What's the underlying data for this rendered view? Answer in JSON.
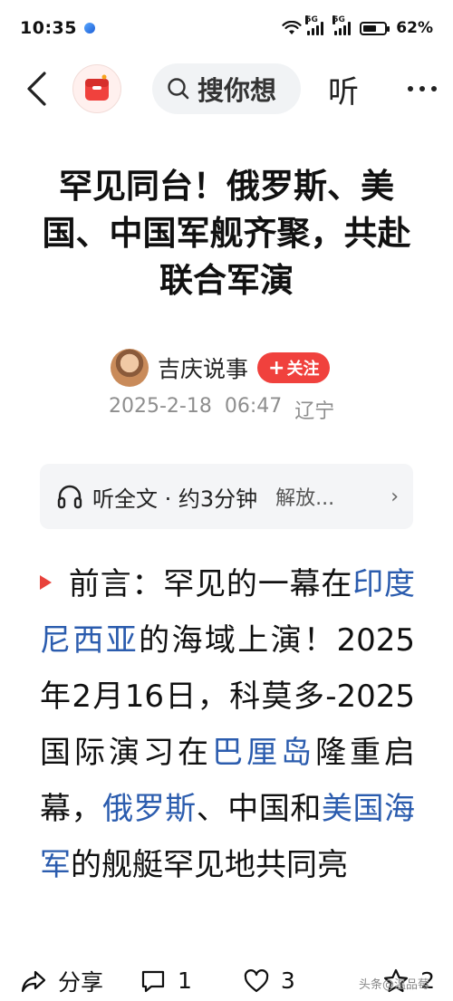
{
  "status_bar": {
    "time": "10:35",
    "network_1": "5G",
    "network_2": "5G",
    "battery_percent": "62%",
    "battery_level": 0.62
  },
  "nav": {
    "search_text": "搜你想",
    "listen_label": "听"
  },
  "article": {
    "title": "罕见同台！俄罗斯、美国、中国军舰齐聚，共赴联合军演",
    "author": "吉庆说事",
    "follow_label": "关注",
    "date": "2025-2-18",
    "time": "06:47",
    "location": "辽宁",
    "listen_bar": {
      "label": "听全文 · 约3分钟",
      "extra": "解放..."
    },
    "body": {
      "p1_prefix": "前言：罕见的一幕在",
      "link_1": "印度尼西亚",
      "p1_mid_1": "的海域上演！2025年2月16日，科莫多-2025国际演习在",
      "link_2": "巴厘岛",
      "p1_mid_2": "隆重启幕，",
      "link_3": "俄罗斯",
      "p1_mid_3": "、中国和",
      "link_4": "美国海军",
      "p1_suffix": "的舰艇罕见地共同亮"
    }
  },
  "bottom_bar": {
    "share_label": "分享",
    "comment_count": "1",
    "like_count": "3",
    "favorite_count": "2",
    "watermark": "头条@温品莓"
  },
  "colors": {
    "accent_red": "#f0413d",
    "link_blue": "#2b5cae"
  }
}
